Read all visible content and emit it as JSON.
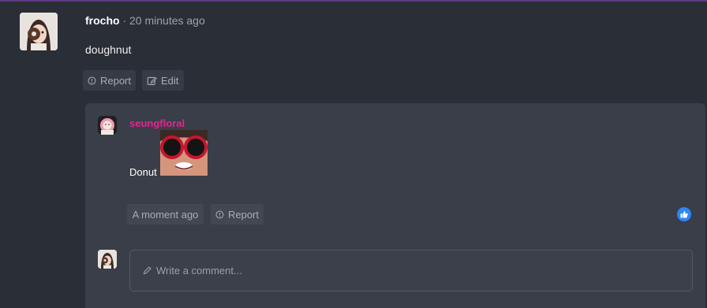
{
  "comment": {
    "username": "frocho",
    "separator": " · ",
    "time": "20 minutes ago",
    "body": "doughnut",
    "actions": {
      "report_label": "Report",
      "edit_label": "Edit"
    }
  },
  "reply": {
    "username": "seungfloral",
    "text": "Donut",
    "time": "A moment ago",
    "report_label": "Report",
    "like": {
      "icon": "thumbs-up-icon",
      "color": "#2f86f6"
    }
  },
  "composer": {
    "placeholder": "Write a comment..."
  },
  "colors": {
    "accent_bar": "#5e3a86",
    "reply_username": "#e8218f"
  }
}
